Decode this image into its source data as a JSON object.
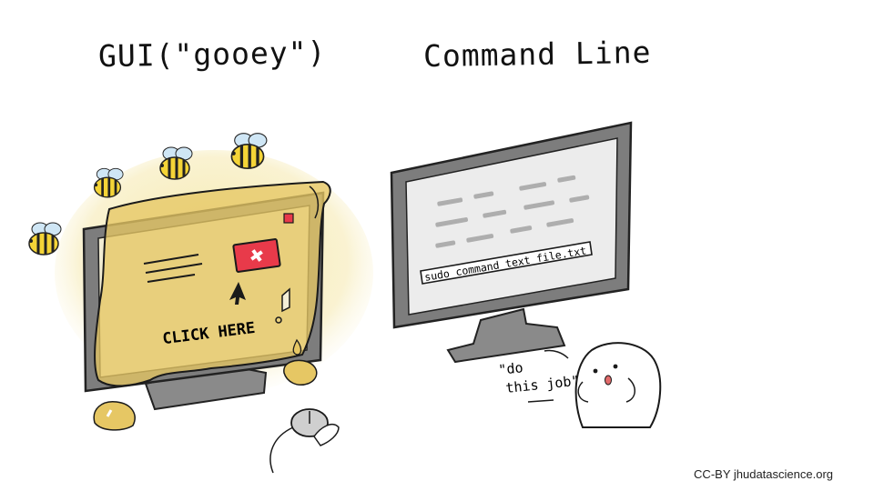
{
  "titles": {
    "gui": "GUI(\"gooey\")",
    "cli": "Command Line"
  },
  "gui_screen": {
    "click_label": "CLICK HERE"
  },
  "cli_screen": {
    "command": "sudo command text file.txt"
  },
  "speech": {
    "line1": "\"do",
    "line2": "this job\""
  },
  "credit": "CC-BY jhudatascience.org",
  "colors": {
    "goo": "#e6c764",
    "goo_dark": "#c9a648",
    "monitor": "#7d7d7d",
    "screen_cli": "#ececec",
    "close_red": "#e83a4a",
    "bee_yellow": "#f4d437",
    "wing_blue": "#cfe6f5"
  }
}
